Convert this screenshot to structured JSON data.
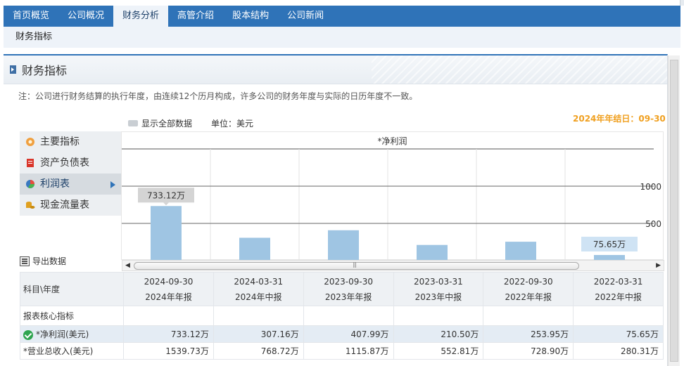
{
  "nav": {
    "tabs": [
      {
        "label": "首页概览"
      },
      {
        "label": "公司概况"
      },
      {
        "label": "财务分析",
        "active": true
      },
      {
        "label": "高管介绍"
      },
      {
        "label": "股本结构"
      },
      {
        "label": "公司新闻"
      }
    ],
    "subnav_label": "财务指标"
  },
  "section": {
    "title": "财务指标",
    "note": "注：公司进行财务结算的执行年度，由连续12个历月构成，许多公司的财务年度与实际的日历年度不一致。",
    "show_all_label": "显示全部数据",
    "unit_label": "单位：美元",
    "year_end_label": "2024年年结日：09-30",
    "export_label": "导出数据"
  },
  "left_menu": [
    {
      "label": "主要指标",
      "icon": "gear-flower-icon",
      "color": "#f0a040"
    },
    {
      "label": "资产负债表",
      "icon": "document-icon",
      "color": "#d9362b"
    },
    {
      "label": "利润表",
      "icon": "pie-chart-icon",
      "color": "#3a78c0",
      "active": true
    },
    {
      "label": "现金流量表",
      "icon": "coins-icon",
      "color": "#e0a020"
    }
  ],
  "chart_data": {
    "type": "bar",
    "title": "*净利润",
    "categories": [
      "2024-09-30",
      "2024-03-31",
      "2023-09-30",
      "2023-03-31",
      "2022-09-30",
      "2022-03-31"
    ],
    "values": [
      733.12,
      307.16,
      407.99,
      210.5,
      253.95,
      75.65
    ],
    "unit": "万",
    "y_ticks": [
      500,
      1000
    ],
    "ylim": [
      0,
      1000
    ],
    "bar_color": "#9fc5e3",
    "callouts": [
      {
        "index": 0,
        "label": "733.12万"
      },
      {
        "index": 5,
        "label": "75.65万"
      }
    ]
  },
  "table": {
    "corner_label": "科目\\年度",
    "periods": [
      {
        "date": "2024-09-30",
        "report": "2024年年报"
      },
      {
        "date": "2024-03-31",
        "report": "2024年中报"
      },
      {
        "date": "2023-09-30",
        "report": "2023年年报"
      },
      {
        "date": "2023-03-31",
        "report": "2023年中报"
      },
      {
        "date": "2022-09-30",
        "report": "2022年年报"
      },
      {
        "date": "2022-03-31",
        "report": "2022年中报"
      }
    ],
    "section_label": "报表核心指标",
    "rows": [
      {
        "label": "*净利润(美元)",
        "values": [
          "733.12万",
          "307.16万",
          "407.99万",
          "210.50万",
          "253.95万",
          "75.65万"
        ],
        "checked": true
      },
      {
        "label": "*营业总收入(美元)",
        "values": [
          "1539.73万",
          "768.72万",
          "1115.87万",
          "552.81万",
          "728.90万",
          "280.31万"
        ]
      }
    ]
  }
}
